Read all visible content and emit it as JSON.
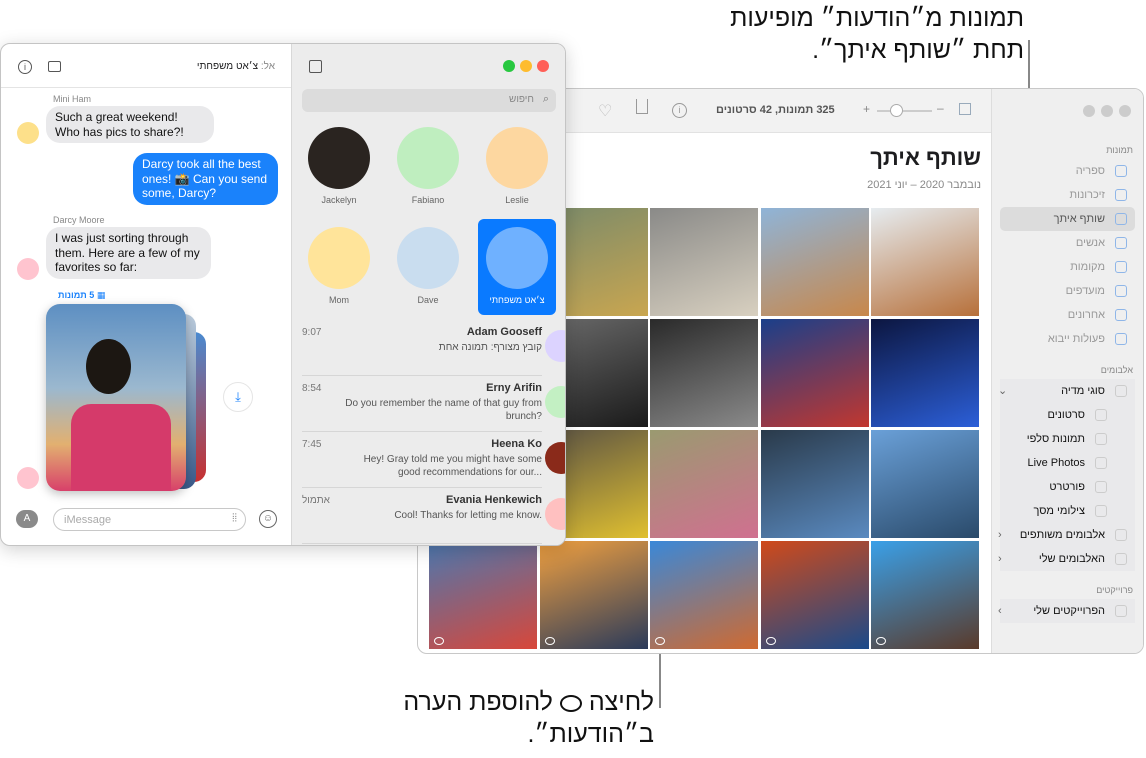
{
  "callouts": {
    "top_line1": "תמונות מ״הודעות״ מופיעות",
    "top_line2": "תחת ״שותף איתך״.",
    "bottom_line1_a": "לחיצה",
    "bottom_line1_b": "להוספת הערה",
    "bottom_line2": "ב״הודעות״."
  },
  "photos": {
    "toolbar": {
      "count": "325 תמונות, 42 סרטונים",
      "zoom_minus": "–",
      "zoom_plus": "+",
      "zoom_level": 0.35
    },
    "title": "שותף איתך",
    "date_range": "נובמבר 2020 – יוני 2021",
    "sidebar": {
      "section_photos": "תמונות",
      "items": [
        "ספריה",
        "זיכרונות",
        "שותף איתך",
        "אנשים",
        "מקומות",
        "מועדפים",
        "אחרונים",
        "פעולות ייבוא"
      ],
      "section_albums": "אלבומים",
      "albums": [
        "סוגי מדיה",
        "סרטונים",
        "תמונות סלפי",
        "Live Photos",
        "פורטרט",
        "צילומי מסך",
        "אלבומים משותפים",
        "האלבומים שלי"
      ],
      "section_projects": "פרוייקטים",
      "projects": [
        "הפרוייקטים שלי"
      ]
    },
    "tiles": [
      {
        "c1": "#6b7a4a",
        "c2": "#e8c23a",
        "comment": false
      },
      {
        "c1": "#7a8a6a",
        "c2": "#c9a650",
        "comment": false
      },
      {
        "c1": "#8a8a88",
        "c2": "#d8d0c0",
        "comment": false
      },
      {
        "c1": "#8fb4d8",
        "c2": "#c8874a",
        "comment": false
      },
      {
        "c1": "#e6ecf0",
        "c2": "#b7703a",
        "comment": false
      },
      {
        "c1": "#3a2a1a",
        "c2": "#b04030",
        "comment": false
      },
      {
        "c1": "#6a6a6a",
        "c2": "#1a1a1a",
        "comment": false
      },
      {
        "c1": "#2a2a2a",
        "c2": "#8a8a8a",
        "comment": false
      },
      {
        "c1": "#1a3f8a",
        "c2": "#c2372f",
        "comment": false
      },
      {
        "c1": "#0c1640",
        "c2": "#2c5fd8",
        "comment": false
      },
      {
        "c1": "#c8d0b8",
        "c2": "#8aa070",
        "comment": false
      },
      {
        "c1": "#5a5244",
        "c2": "#e0c030",
        "comment": false
      },
      {
        "c1": "#9a9a70",
        "c2": "#d07090",
        "comment": false
      },
      {
        "c1": "#2a3a4a",
        "c2": "#5a8ac0",
        "comment": false
      },
      {
        "c1": "#6aa0d8",
        "c2": "#2a4a6a",
        "comment": false
      },
      {
        "c1": "#4a78b0",
        "c2": "#d8473a",
        "comment": true
      },
      {
        "c1": "#f0a040",
        "c2": "#2a3a5a",
        "comment": true
      },
      {
        "c1": "#3a88d8",
        "c2": "#d06a30",
        "comment": true
      },
      {
        "c1": "#d04a1a",
        "c2": "#1a4a8a",
        "comment": true
      },
      {
        "c1": "#3aa0e8",
        "c2": "#5a3a2a",
        "comment": true
      }
    ]
  },
  "messages": {
    "to_label": "אל:",
    "to_name": "צ׳אט משפחתי",
    "search_placeholder": "חיפוש",
    "pinned": [
      {
        "name": "Leslie",
        "color": "#fdd7a0"
      },
      {
        "name": "Fabiano",
        "color": "#bfeebf"
      },
      {
        "name": "Jackelyn",
        "color": "#2a2420"
      },
      {
        "name": "צ׳אט משפחתי",
        "color": "#6fb1ff"
      },
      {
        "name": "Dave",
        "color": "#c9ddef"
      },
      {
        "name": "Mom",
        "color": "#ffe49a"
      }
    ],
    "conversations": [
      {
        "name": "Adam Gooseff",
        "time": "9:07",
        "preview": "קובץ מצורף: תמונה אחת",
        "color": "#dcd3ff"
      },
      {
        "name": "Erny Arifin",
        "time": "8:54",
        "preview": "Do you remember the name of that guy from brunch?",
        "color": "#c3f0c3"
      },
      {
        "name": "Heena Ko",
        "time": "7:45",
        "preview": "Hey! Gray told me you might have some good recommendations for our...",
        "color": "#8a2a1a"
      },
      {
        "name": "Evania Henkewich",
        "time": "אתמול",
        "preview": "Cool! Thanks for letting me know.",
        "color": "#ffc0c0"
      }
    ],
    "chat": [
      {
        "sender": "Mini Ham",
        "text": "Such a great weekend! Who has pics to share?!"
      },
      {
        "text": "Darcy took all the best ones! 📸 Can you send some, Darcy?"
      },
      {
        "sender": "Darcy Moore",
        "text": "I was just sorting through them. Here are a few of my favorites so far:"
      }
    ],
    "photo_stack_label": "5 תמונות",
    "input_placeholder": "iMessage",
    "colors": {
      "accent": "#0a7aff",
      "close": "#ff5f57",
      "minimize": "#febc2e",
      "zoom": "#28c840"
    }
  }
}
